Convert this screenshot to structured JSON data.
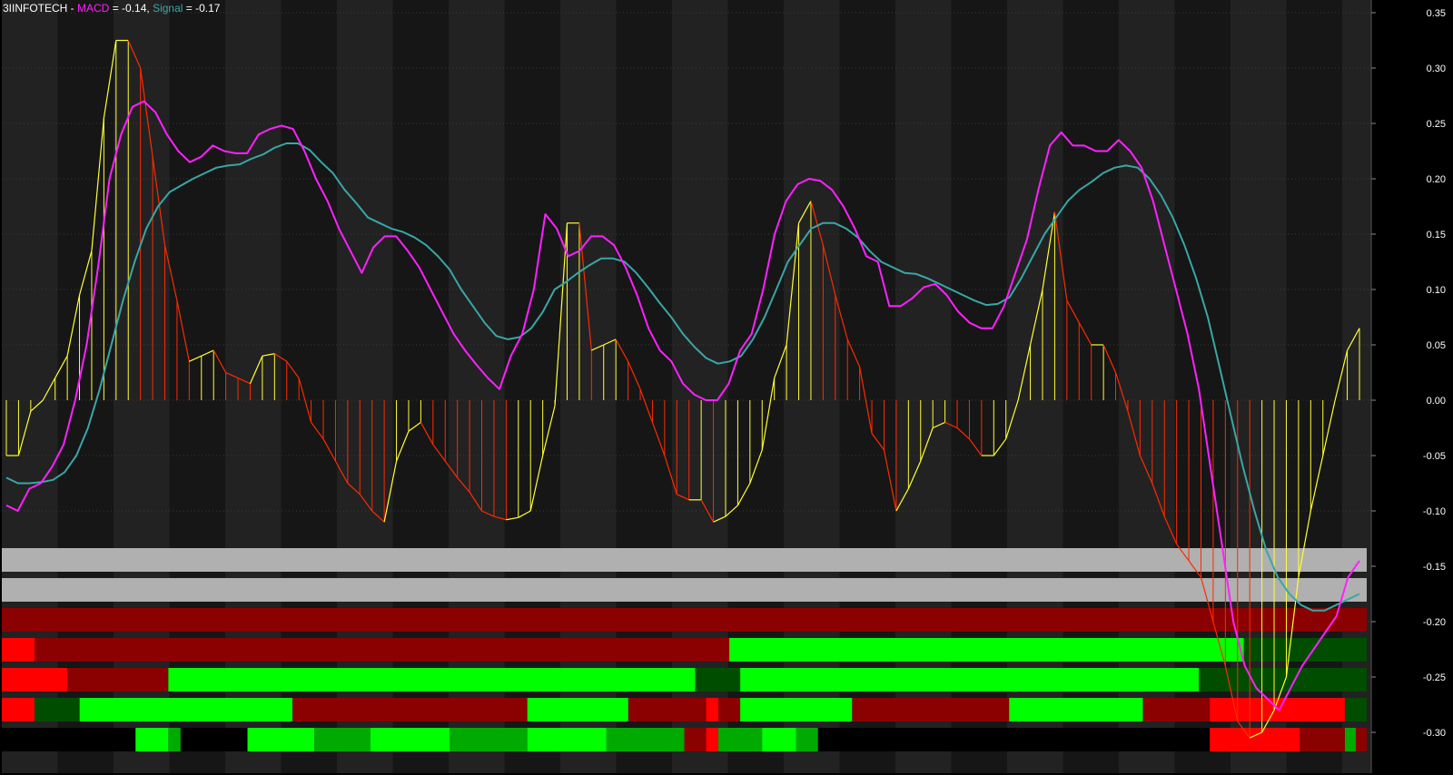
{
  "header": {
    "symbol": "3IINFOTECH",
    "sep1": " - ",
    "macd_label": "MACD",
    "macd_eq": " = -0.14, ",
    "signal_label": "Signal",
    "signal_eq": " = -0.17"
  },
  "colors": {
    "background_light": "#222222",
    "background_dark": "#161616",
    "macd": "#ff20ff",
    "signal": "#3aa6a6",
    "hist_rising": "#ffff33",
    "hist_falling": "#ff2a00",
    "bright_red": "#ff0000",
    "dark_red": "#8b0000",
    "bright_green": "#00ff00",
    "mid_green": "#00aa00",
    "dark_green": "#004d00",
    "gray": "#b0b0b0"
  },
  "chart_data": {
    "type": "line",
    "y_axis_side": "right",
    "ylim": [
      -0.32,
      0.36
    ],
    "yticks": [
      0.35,
      0.3,
      0.25,
      0.2,
      0.15,
      0.1,
      0.05,
      0.0,
      -0.05,
      -0.1,
      -0.15,
      -0.2,
      -0.25,
      -0.3
    ],
    "ytick_labels": [
      "0.35",
      "0.30",
      "0.25",
      "0.20",
      "0.15",
      "0.10",
      "0.05",
      "0.00",
      "-0.05",
      "-0.10",
      "-0.15",
      "-0.20",
      "-0.25",
      "-0.30"
    ],
    "grid": true,
    "series": [
      {
        "name": "MACD",
        "color": "#ff20ff",
        "values": [
          -0.095,
          -0.1,
          -0.08,
          -0.075,
          -0.06,
          -0.04,
          0.0,
          0.05,
          0.12,
          0.2,
          0.24,
          0.265,
          0.27,
          0.26,
          0.24,
          0.225,
          0.215,
          0.22,
          0.23,
          0.225,
          0.223,
          0.223,
          0.24,
          0.245,
          0.248,
          0.245,
          0.225,
          0.2,
          0.18,
          0.155,
          0.135,
          0.115,
          0.138,
          0.148,
          0.148,
          0.135,
          0.12,
          0.1,
          0.08,
          0.06,
          0.045,
          0.032,
          0.02,
          0.01,
          0.04,
          0.06,
          0.1,
          0.168,
          0.155,
          0.13,
          0.135,
          0.148,
          0.148,
          0.14,
          0.12,
          0.095,
          0.065,
          0.045,
          0.035,
          0.015,
          0.005,
          0.0,
          0.0,
          0.015,
          0.045,
          0.06,
          0.1,
          0.15,
          0.18,
          0.195,
          0.2,
          0.198,
          0.19,
          0.175,
          0.155,
          0.13,
          0.125,
          0.085,
          0.085,
          0.092,
          0.102,
          0.105,
          0.095,
          0.08,
          0.07,
          0.065,
          0.065,
          0.085,
          0.115,
          0.145,
          0.19,
          0.23,
          0.242,
          0.23,
          0.23,
          0.225,
          0.225,
          0.235,
          0.225,
          0.21,
          0.18,
          0.14,
          0.1,
          0.06,
          0.01,
          -0.06,
          -0.13,
          -0.2,
          -0.24,
          -0.26,
          -0.27,
          -0.28,
          -0.26,
          -0.24,
          -0.225,
          -0.21,
          -0.195,
          -0.16,
          -0.145
        ]
      },
      {
        "name": "Signal",
        "color": "#3aa6a6",
        "values": [
          -0.07,
          -0.075,
          -0.075,
          -0.074,
          -0.072,
          -0.065,
          -0.05,
          -0.025,
          0.01,
          0.05,
          0.09,
          0.125,
          0.155,
          0.175,
          0.188,
          0.194,
          0.2,
          0.205,
          0.21,
          0.212,
          0.213,
          0.218,
          0.222,
          0.228,
          0.232,
          0.232,
          0.226,
          0.215,
          0.205,
          0.19,
          0.178,
          0.165,
          0.16,
          0.155,
          0.152,
          0.147,
          0.14,
          0.13,
          0.118,
          0.1,
          0.085,
          0.07,
          0.058,
          0.055,
          0.057,
          0.065,
          0.08,
          0.1,
          0.107,
          0.115,
          0.122,
          0.128,
          0.128,
          0.125,
          0.115,
          0.102,
          0.088,
          0.075,
          0.06,
          0.048,
          0.038,
          0.033,
          0.035,
          0.04,
          0.055,
          0.075,
          0.1,
          0.125,
          0.14,
          0.155,
          0.16,
          0.16,
          0.155,
          0.147,
          0.135,
          0.125,
          0.12,
          0.115,
          0.114,
          0.11,
          0.105,
          0.1,
          0.095,
          0.09,
          0.086,
          0.087,
          0.093,
          0.11,
          0.13,
          0.15,
          0.165,
          0.18,
          0.19,
          0.197,
          0.205,
          0.21,
          0.212,
          0.21,
          0.2,
          0.185,
          0.165,
          0.14,
          0.11,
          0.075,
          0.03,
          -0.015,
          -0.06,
          -0.1,
          -0.135,
          -0.16,
          -0.175,
          -0.185,
          -0.19,
          -0.19,
          -0.185,
          -0.18,
          -0.175
        ]
      },
      {
        "name": "Histogram",
        "color": "#ffff33",
        "values": [
          -0.05,
          -0.05,
          -0.01,
          0.0,
          0.02,
          0.04,
          0.095,
          0.135,
          0.255,
          0.325,
          0.325,
          0.3,
          0.22,
          0.14,
          0.09,
          0.035,
          0.04,
          0.045,
          0.025,
          0.02,
          0.015,
          0.04,
          0.042,
          0.035,
          0.02,
          -0.02,
          -0.035,
          -0.055,
          -0.075,
          -0.085,
          -0.1,
          -0.11,
          -0.055,
          -0.028,
          -0.02,
          -0.04,
          -0.055,
          -0.07,
          -0.083,
          -0.1,
          -0.105,
          -0.108,
          -0.106,
          -0.1,
          -0.05,
          -0.005,
          0.16,
          0.16,
          0.045,
          0.05,
          0.055,
          0.035,
          0.01,
          -0.02,
          -0.05,
          -0.085,
          -0.09,
          -0.09,
          -0.11,
          -0.105,
          -0.095,
          -0.075,
          -0.045,
          0.02,
          0.05,
          0.16,
          0.18,
          0.14,
          0.095,
          0.055,
          0.03,
          -0.03,
          -0.045,
          -0.1,
          -0.08,
          -0.055,
          -0.025,
          -0.02,
          -0.025,
          -0.035,
          -0.05,
          -0.05,
          -0.035,
          0.0,
          0.05,
          0.1,
          0.17,
          0.09,
          0.07,
          0.05,
          0.05,
          0.025,
          -0.01,
          -0.05,
          -0.075,
          -0.105,
          -0.13,
          -0.145,
          -0.16,
          -0.2,
          -0.24,
          -0.29,
          -0.305,
          -0.3,
          -0.28,
          -0.25,
          -0.16,
          -0.1,
          -0.05,
          0.0,
          0.045,
          0.065
        ]
      }
    ],
    "indicator_bars": [
      [
        {
          "from": 0.0,
          "to": 1.0,
          "color": "#b0b0b0"
        }
      ],
      [
        {
          "from": 0.0,
          "to": 1.0,
          "color": "#b0b0b0"
        }
      ],
      [
        {
          "from": 0.0,
          "to": 1.0,
          "color": "#8b0000"
        }
      ],
      [
        {
          "from": 0.0,
          "to": 0.024,
          "color": "#ff0000"
        },
        {
          "from": 0.024,
          "to": 0.533,
          "color": "#8b0000"
        },
        {
          "from": 0.533,
          "to": 0.91,
          "color": "#00ff00"
        },
        {
          "from": 0.91,
          "to": 1.0,
          "color": "#004d00"
        }
      ],
      [
        {
          "from": 0.0,
          "to": 0.048,
          "color": "#ff0000"
        },
        {
          "from": 0.048,
          "to": 0.122,
          "color": "#8b0000"
        },
        {
          "from": 0.122,
          "to": 0.508,
          "color": "#00ff00"
        },
        {
          "from": 0.508,
          "to": 0.541,
          "color": "#004d00"
        },
        {
          "from": 0.541,
          "to": 0.877,
          "color": "#00ff00"
        },
        {
          "from": 0.877,
          "to": 1.0,
          "color": "#004d00"
        }
      ],
      [
        {
          "from": 0.0,
          "to": 0.024,
          "color": "#ff0000"
        },
        {
          "from": 0.024,
          "to": 0.057,
          "color": "#004d00"
        },
        {
          "from": 0.057,
          "to": 0.213,
          "color": "#00ff00"
        },
        {
          "from": 0.213,
          "to": 0.385,
          "color": "#8b0000"
        },
        {
          "from": 0.385,
          "to": 0.459,
          "color": "#00ff00"
        },
        {
          "from": 0.459,
          "to": 0.516,
          "color": "#8b0000"
        },
        {
          "from": 0.516,
          "to": 0.525,
          "color": "#ff0000"
        },
        {
          "from": 0.525,
          "to": 0.541,
          "color": "#8b0000"
        },
        {
          "from": 0.541,
          "to": 0.623,
          "color": "#00ff00"
        },
        {
          "from": 0.623,
          "to": 0.738,
          "color": "#8b0000"
        },
        {
          "from": 0.738,
          "to": 0.836,
          "color": "#00ff00"
        },
        {
          "from": 0.836,
          "to": 0.885,
          "color": "#8b0000"
        },
        {
          "from": 0.885,
          "to": 0.984,
          "color": "#ff0000"
        },
        {
          "from": 0.984,
          "to": 1.0,
          "color": "#004d00"
        }
      ],
      [
        {
          "from": 0.0,
          "to": 0.098,
          "color": "#000000"
        },
        {
          "from": 0.098,
          "to": 0.122,
          "color": "#00ff00"
        },
        {
          "from": 0.122,
          "to": 0.131,
          "color": "#00aa00"
        },
        {
          "from": 0.131,
          "to": 0.18,
          "color": "#000000"
        },
        {
          "from": 0.18,
          "to": 0.229,
          "color": "#00ff00"
        },
        {
          "from": 0.229,
          "to": 0.27,
          "color": "#00aa00"
        },
        {
          "from": 0.27,
          "to": 0.328,
          "color": "#00ff00"
        },
        {
          "from": 0.328,
          "to": 0.385,
          "color": "#00aa00"
        },
        {
          "from": 0.385,
          "to": 0.443,
          "color": "#00ff00"
        },
        {
          "from": 0.443,
          "to": 0.5,
          "color": "#00aa00"
        },
        {
          "from": 0.5,
          "to": 0.516,
          "color": "#8b0000"
        },
        {
          "from": 0.516,
          "to": 0.525,
          "color": "#ff0000"
        },
        {
          "from": 0.525,
          "to": 0.557,
          "color": "#00aa00"
        },
        {
          "from": 0.557,
          "to": 0.582,
          "color": "#00ff00"
        },
        {
          "from": 0.582,
          "to": 0.598,
          "color": "#00aa00"
        },
        {
          "from": 0.598,
          "to": 0.885,
          "color": "#000000"
        },
        {
          "from": 0.885,
          "to": 0.951,
          "color": "#ff0000"
        },
        {
          "from": 0.951,
          "to": 0.984,
          "color": "#8b0000"
        },
        {
          "from": 0.984,
          "to": 0.992,
          "color": "#00aa00"
        },
        {
          "from": 0.992,
          "to": 1.0,
          "color": "#8b0000"
        }
      ]
    ]
  }
}
